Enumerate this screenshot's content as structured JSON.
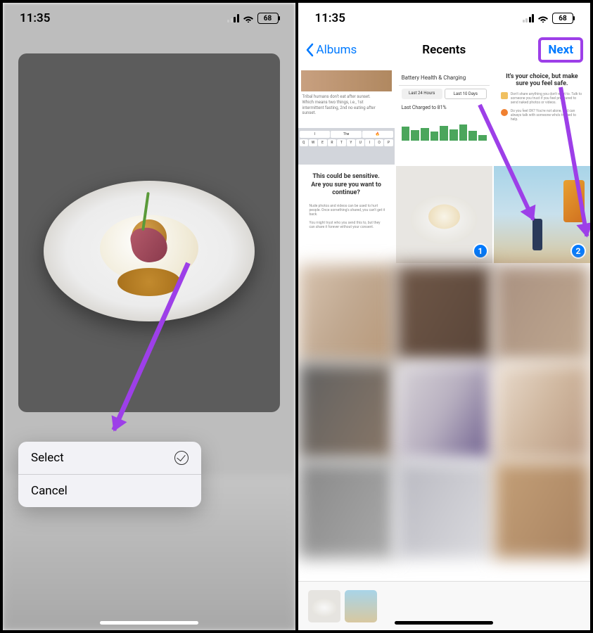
{
  "status": {
    "time": "11:35",
    "battery": "68"
  },
  "left": {
    "menu": {
      "select": "Select",
      "cancel": "Cancel"
    }
  },
  "right": {
    "nav": {
      "back": "Albums",
      "title": "Recents",
      "next": "Next"
    },
    "cells": {
      "c1": {
        "line1": "Tribal humans don't eat after sunset.",
        "line2": "Which means two things, i.e., 1st",
        "line3": "intermittent fasting, 2nd no eating after",
        "line4": "sunset.",
        "sug1": "I",
        "sug2": "The",
        "keys": "QWERTYUIOP"
      },
      "c2": {
        "header": "Battery Health & Charging",
        "tab1": "Last 24 Hours",
        "tab2": "Last 10 Days",
        "charged": "Last Charged to 81%"
      },
      "c3": {
        "title": "It's your choice, but make sure you feel safe.",
        "r1": "Don't share anything you don't want to. Talk to someone you trust if you feel pressured to send naked photos or videos.",
        "r2": "Do you feel OK? You're not alone, and can always talk with someone who's trained to help."
      },
      "c4": {
        "title": "This could be sensitive. Are you sure you want to continue?",
        "r1": "Nude photos and videos can be used to hurt people. Once something's shared, you can't get it back.",
        "r2": "You might trust who you send this to, but they can share it forever without your consent."
      },
      "badge1": "1",
      "badge2": "2"
    }
  }
}
